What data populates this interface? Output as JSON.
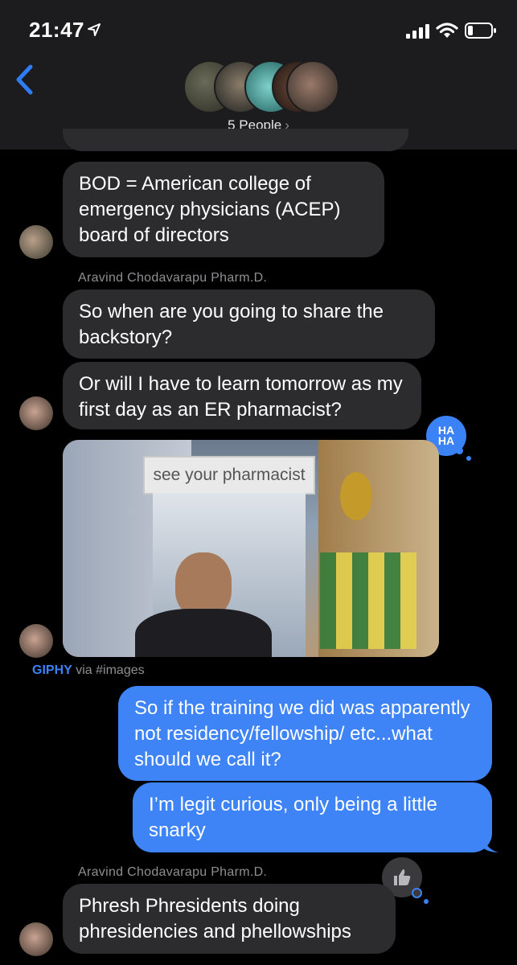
{
  "status_bar": {
    "time": "21:47"
  },
  "header": {
    "group_label": "5 People",
    "chevron": "›"
  },
  "messages": [
    {
      "text": "BOD = American college of emergency physicians (ACEP) board of directors"
    },
    {
      "sender": "Aravind Chodavarapu Pharm.D."
    },
    {
      "text": "So when are you going to share the backstory?"
    },
    {
      "text": "Or will I have to learn tomorrow as my first day as an ER pharmacist?"
    },
    {
      "reaction": "HA HA"
    },
    {
      "gif_sign": "see your pharmacist",
      "source_brand": "GIPHY",
      "source_via": " via #images"
    },
    {
      "text": "So if the training we did was apparently not residency/fellowship/ etc...what should we call it?"
    },
    {
      "text": "I’m legit curious, only being a little snarky"
    },
    {
      "sender": "Aravind Chodavarapu Pharm.D."
    },
    {
      "text": "Phresh Phresidents doing phresidencies and phellowships"
    }
  ],
  "colors": {
    "incoming_bubble": "#2c2c2e",
    "outgoing_bubble": "#3e84f7",
    "accent": "#3b82f6",
    "header_bg": "#1c1c1e"
  },
  "icons": [
    "location-arrow-icon",
    "signal-bars-icon",
    "wifi-icon",
    "battery-icon",
    "back-chevron-icon",
    "thumbs-up-icon",
    "haha-reaction-icon"
  ]
}
